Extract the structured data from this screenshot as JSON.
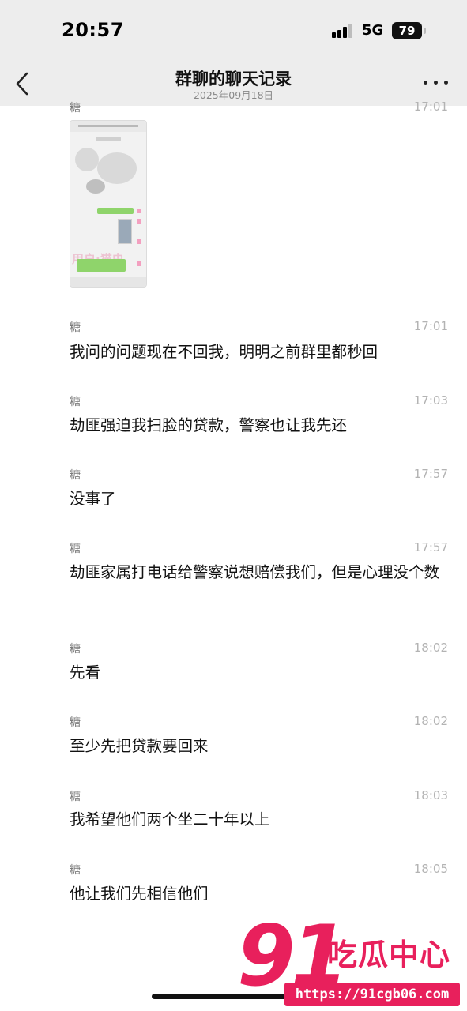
{
  "status_bar": {
    "time": "20:57",
    "network": "5G",
    "battery": "79"
  },
  "nav": {
    "title": "群聊的聊天记录",
    "date": "2025年09月18日"
  },
  "messages": [
    {
      "sender": "糖",
      "time": "17:01",
      "type": "image"
    },
    {
      "sender": "糖",
      "time": "17:01",
      "text": "我问的问题现在不回我，明明之前群里都秒回"
    },
    {
      "sender": "糖",
      "time": "17:03",
      "text": "劫匪强迫我扫脸的贷款，警察也让我先还"
    },
    {
      "sender": "糖",
      "time": "17:57",
      "text": "没事了"
    },
    {
      "sender": "糖",
      "time": "17:57",
      "text": "劫匪家属打电话给警察说想赔偿我们，但是心理没个数"
    },
    {
      "sender": "糖",
      "time": "18:02",
      "text": "先看"
    },
    {
      "sender": "糖",
      "time": "18:02",
      "text": "至少先把贷款要回来"
    },
    {
      "sender": "糖",
      "time": "18:03",
      "text": "我希望他们两个坐二十年以上"
    },
    {
      "sender": "糖",
      "time": "18:05",
      "text": "他让我们先相信他们"
    }
  ],
  "watermark": {
    "number": "91",
    "name": "吃瓜中心",
    "url": "https://91cgb06.com"
  },
  "colors": {
    "accent": "#e8205c",
    "bubble_green": "#8fd46b",
    "nav_bg": "#ededed"
  }
}
